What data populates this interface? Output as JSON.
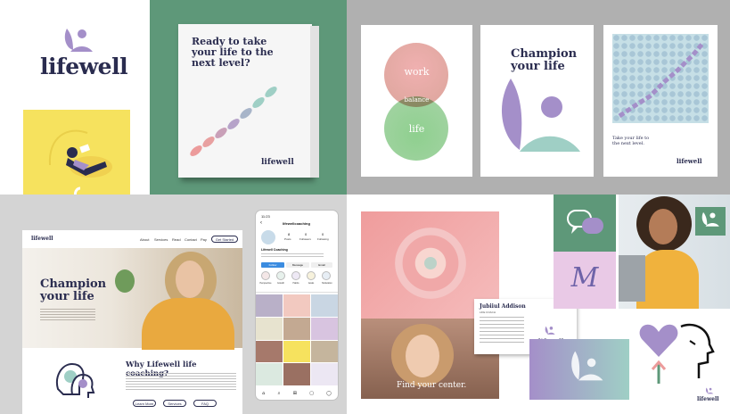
{
  "brand": {
    "wordmark": "lifewell",
    "colors": {
      "green": "#5e9879",
      "yellow": "#f6e25e",
      "lavender": "#a48fc9",
      "pink": "#ec9b9b",
      "teal": "#9fcfc5",
      "navy": "#2a2c4f"
    }
  },
  "magazine": {
    "headline": "Ready to take your life to the next level?",
    "logo": "lifewell"
  },
  "posters": {
    "venn": {
      "top": "work",
      "middle": "balance",
      "bottom": "life"
    },
    "champion": {
      "headline": "Champion your life"
    },
    "pattern": {
      "caption": "Take your life to the next level.",
      "logo": "lifewell"
    }
  },
  "website": {
    "logo": "lifewell",
    "nav": [
      "About",
      "Services",
      "Read",
      "Contact",
      "Pay"
    ],
    "cta": "Get Started",
    "hero_headline": "Champion your life",
    "section_title": "Why Lifewell life coaching?",
    "buttons": [
      "Learn More",
      "Services",
      "FAQ"
    ]
  },
  "social": {
    "time": "11:23",
    "handle": "lifewellcoaching",
    "stats": [
      {
        "value": "8",
        "label": "Posts"
      },
      {
        "value": "0",
        "label": "Followers"
      },
      {
        "value": "0",
        "label": "Following"
      }
    ],
    "profile_name": "Lifewell Coaching",
    "follow_label": "Follow",
    "message_label": "Message",
    "email_label": "Email",
    "highlights": [
      "Perspective",
      "Growth",
      "Habits",
      "Goals",
      "Motivation"
    ]
  },
  "card": {
    "title": "Jubiiul Addison",
    "role": "LIFE COACH",
    "logo": "lifewell"
  },
  "photo": {
    "tagline": "Find your center."
  },
  "icons": {
    "monogram": "M",
    "logo": "lifewell"
  }
}
